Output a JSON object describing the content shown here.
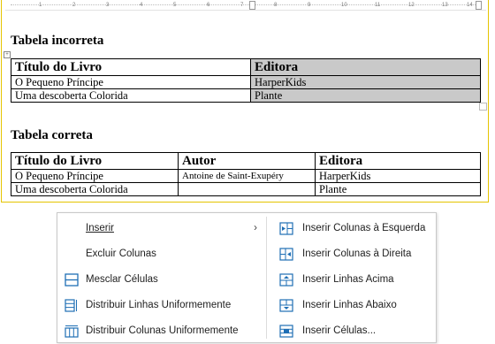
{
  "ruler": {
    "marks": [
      "1",
      "2",
      "3",
      "4",
      "5",
      "6",
      "7",
      "8",
      "9",
      "10",
      "11",
      "12",
      "13",
      "14"
    ]
  },
  "table1": {
    "heading": "Tabela incorreta",
    "headers": [
      "Título do Livro",
      "Editora"
    ],
    "rows": [
      [
        "O Pequeno Príncipe",
        "HarperKids"
      ],
      [
        "Uma descoberta Colorida",
        "Plante"
      ]
    ]
  },
  "table2": {
    "heading": "Tabela correta",
    "headers": [
      "Título do Livro",
      "Autor",
      "Editora"
    ],
    "rows": [
      [
        "O Pequeno Príncipe",
        "Antoine de Saint-Exupéry",
        "HarperKids"
      ],
      [
        "Uma descoberta Colorida",
        "",
        "Plante"
      ]
    ]
  },
  "menu": {
    "left": [
      {
        "label": "Inserir",
        "icon": "none",
        "submenu": true
      },
      {
        "label": "Excluir Colunas",
        "icon": "none"
      },
      {
        "label": "Mesclar Células",
        "icon": "merge-cells-icon"
      },
      {
        "label": "Distribuir Linhas Uniformemente",
        "icon": "distribute-rows-icon"
      },
      {
        "label": "Distribuir Colunas Uniformemente",
        "icon": "distribute-columns-icon"
      }
    ],
    "right": [
      {
        "label": "Inserir Colunas à Esquerda",
        "icon": "insert-columns-left-icon"
      },
      {
        "label": "Inserir Colunas à Direita",
        "icon": "insert-columns-right-icon"
      },
      {
        "label": "Inserir Linhas Acima",
        "icon": "insert-rows-above-icon"
      },
      {
        "label": "Inserir Linhas Abaixo",
        "icon": "insert-rows-below-icon"
      },
      {
        "label": "Inserir Células...",
        "icon": "insert-cells-icon"
      }
    ]
  },
  "colors": {
    "accent": "#1f6fb5",
    "grayCell": "#c9c9c9",
    "docBorder": "#e5c400"
  }
}
